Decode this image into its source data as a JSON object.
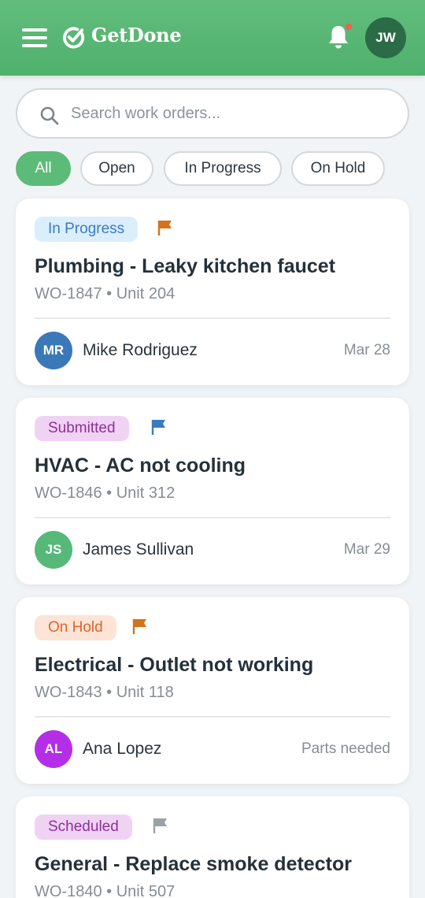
{
  "header": {
    "app_name": "GetDone",
    "user_initials": "JW",
    "brand_color": "#5cbb78",
    "notification_dot_color": "#f0614f"
  },
  "search": {
    "placeholder": "Search work orders...",
    "value": ""
  },
  "filters": [
    {
      "label": "All",
      "active": true
    },
    {
      "label": "Open",
      "active": false
    },
    {
      "label": "In Progress",
      "active": false
    },
    {
      "label": "On Hold",
      "active": false
    }
  ],
  "work_orders": [
    {
      "status": "In Progress",
      "status_bg": "#dbeefc",
      "status_color": "#3a7bbf",
      "flag_color": "#d4731c",
      "title": "Plumbing - Leaky kitchen faucet",
      "id_unit": "WO-1847 • Unit 204",
      "assignee_initials": "MR",
      "assignee_name": "Mike Rodriguez",
      "assignee_color": "#3b78b8",
      "meta": "Mar 28"
    },
    {
      "status": "Submitted",
      "status_bg": "#f0d3f3",
      "status_color": "#8e2fa0",
      "flag_color": "#3a7bbf",
      "title": "HVAC - AC not cooling",
      "id_unit": "WO-1846 • Unit 312",
      "assignee_initials": "JS",
      "assignee_name": "James Sullivan",
      "assignee_color": "#56b879",
      "meta": "Mar 29"
    },
    {
      "status": "On Hold",
      "status_bg": "#fde4d6",
      "status_color": "#e0652c",
      "flag_color": "#d4731c",
      "title": "Electrical - Outlet not working",
      "id_unit": "WO-1843 • Unit 118",
      "assignee_initials": "AL",
      "assignee_name": "Ana Lopez",
      "assignee_color": "#b42ee8",
      "meta": "Parts needed"
    },
    {
      "status": "Scheduled",
      "status_bg": "#f0d3f3",
      "status_color": "#8e2fa0",
      "flag_color": "#9aa2a7",
      "title": "General - Replace smoke detector",
      "id_unit": "WO-1840 • Unit 507"
    }
  ]
}
